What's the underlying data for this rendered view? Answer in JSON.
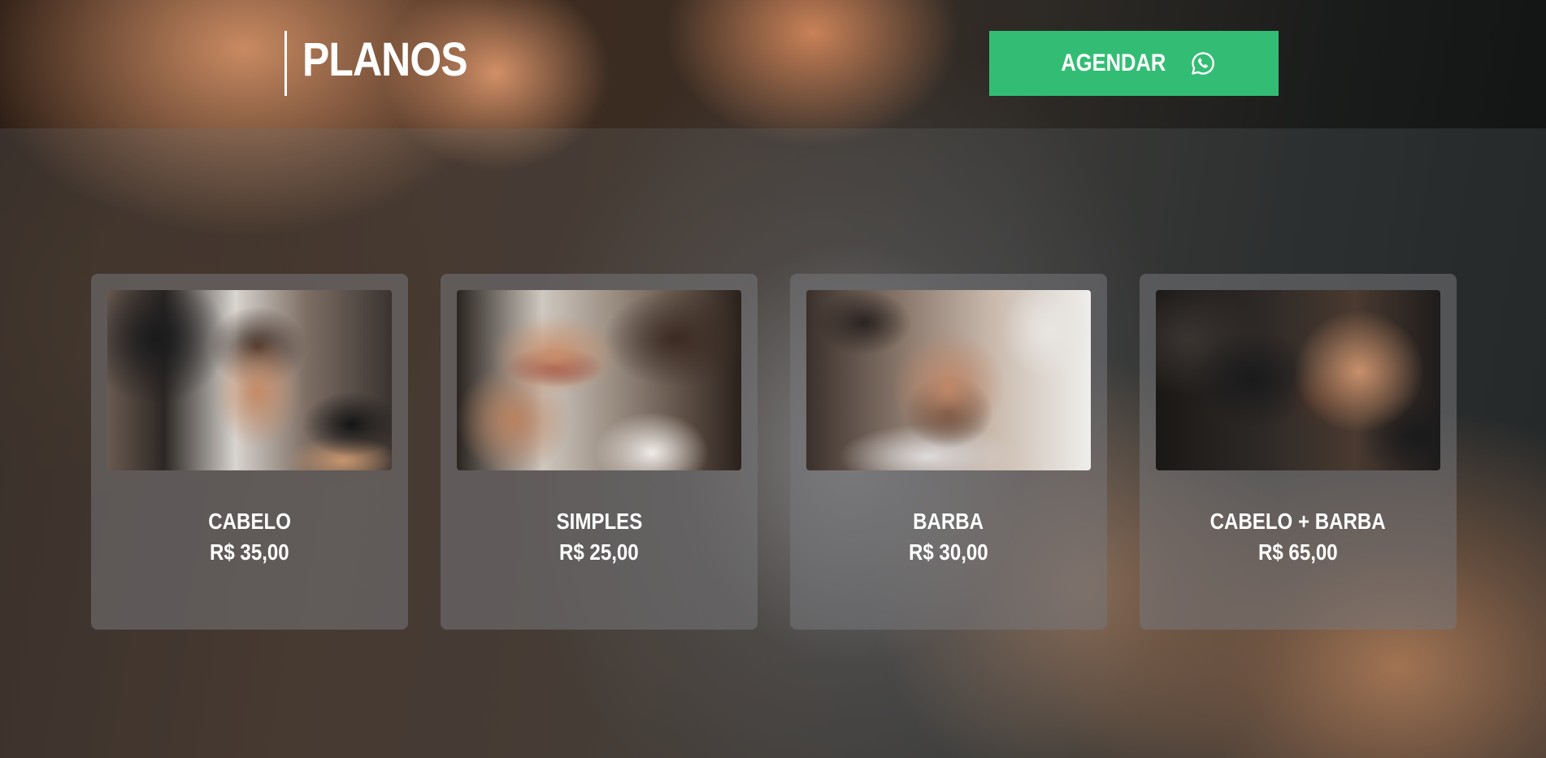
{
  "header": {
    "title": "PLANOS",
    "cta_label": "AGENDAR",
    "cta_icon": "whatsapp-icon",
    "cta_color": "#33bd74"
  },
  "plans": [
    {
      "name": "CABELO",
      "price": "R$ 35,00"
    },
    {
      "name": "SIMPLES",
      "price": "R$ 25,00"
    },
    {
      "name": "BARBA",
      "price": "R$ 30,00"
    },
    {
      "name": "CABELO + BARBA",
      "price": "R$ 65,00"
    }
  ]
}
